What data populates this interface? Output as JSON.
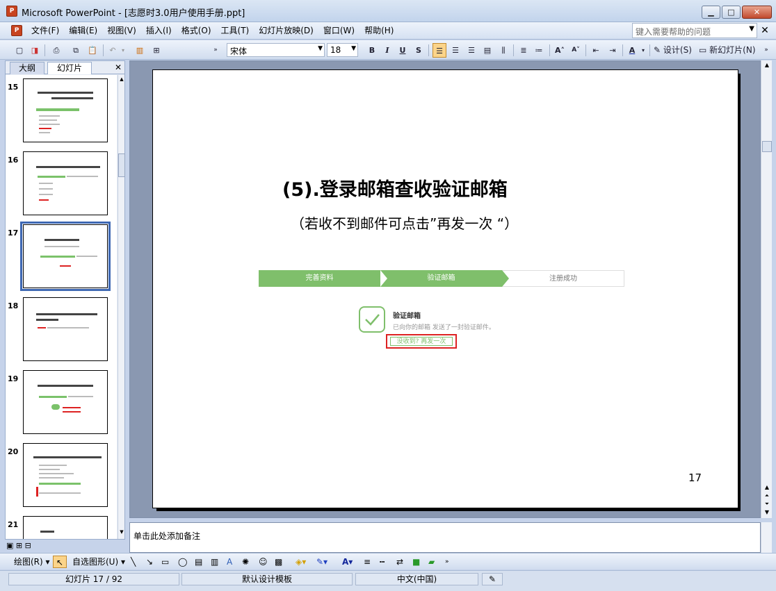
{
  "window": {
    "title": "Microsoft PowerPoint - [志愿时3.0用户使用手册.ppt]",
    "min_label": "▁",
    "max_label": "□",
    "close_label": "✕"
  },
  "menu": {
    "items": [
      "文件(F)",
      "编辑(E)",
      "视图(V)",
      "插入(I)",
      "格式(O)",
      "工具(T)",
      "幻灯片放映(D)",
      "窗口(W)",
      "帮助(H)"
    ],
    "help_placeholder": "键入需要帮助的问题"
  },
  "toolbar": {
    "font": "宋体",
    "size": "18",
    "bold": "B",
    "italic": "I",
    "underline": "U",
    "shadow": "S",
    "design_label": "设计(S)",
    "new_slide_label": "新幻灯片(N)"
  },
  "left_panel": {
    "tab_outline": "大纲",
    "tab_slides": "幻灯片",
    "thumbs": [
      {
        "num": "15"
      },
      {
        "num": "16"
      },
      {
        "num": "17"
      },
      {
        "num": "18"
      },
      {
        "num": "19"
      },
      {
        "num": "20"
      },
      {
        "num": "21"
      }
    ],
    "selected": "17"
  },
  "slide": {
    "title": "(5).登录邮箱查收验证邮箱",
    "subtitle": "（若收不到邮件可点击”再发一次 “）",
    "steps": [
      "完善资料",
      "验证邮箱",
      "注册成功"
    ],
    "verify_title": "验证邮箱",
    "verify_desc": "已向你的邮箱 发送了一封验证邮件。",
    "resend": "没收到? 再发一次",
    "page_number": "17",
    "accent": "#7fbf6b",
    "highlight": "#d22222"
  },
  "notes": {
    "placeholder": "单击此处添加备注"
  },
  "drawbar": {
    "draw_label": "绘图(R)",
    "autoshapes_label": "自选图形(U)"
  },
  "status": {
    "slide_info": "幻灯片 17 / 92",
    "template": "默认设计模板",
    "language": "中文(中国)"
  }
}
